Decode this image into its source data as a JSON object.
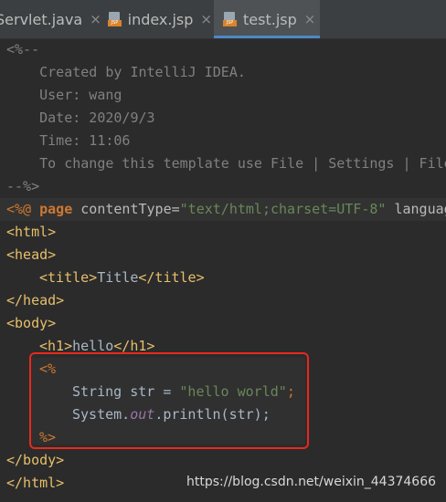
{
  "tabs": [
    {
      "label": "Servlet.java",
      "close": "×",
      "active": false
    },
    {
      "label": "index.jsp",
      "close": "×",
      "active": false
    },
    {
      "label": "test.jsp",
      "close": "×",
      "active": true
    }
  ],
  "code": {
    "comment_open": "<%--",
    "comment_lines": [
      "    Created by IntelliJ IDEA.",
      "    User: wang",
      "    Date: 2020/9/3",
      "    Time: 11:06",
      "    To change this template use File | Settings | File T"
    ],
    "comment_close": "--%>",
    "directive_open": "<%@",
    "directive_keyword": "page",
    "directive_attr": "contentType=",
    "directive_value": "\"text/html;charset=UTF-8\"",
    "directive_rest": " languag",
    "html_open": "<html>",
    "head_open": "<head>",
    "title_open": "<title>",
    "title_text": "Title",
    "title_close": "</title>",
    "head_close": "</head>",
    "body_open": "<body>",
    "h1_open": "<h1>",
    "h1_text": "hello",
    "h1_close": "</h1>",
    "scriptlet_open": "<%",
    "java_line1_a": "String str = ",
    "java_line1_str": "\"hello world\"",
    "java_line1_end": ";",
    "java_line2_a": "System.",
    "java_line2_field": "out",
    "java_line2_b": ".println(str);",
    "scriptlet_close": "%>",
    "body_close": "</body>",
    "html_close": "</html>"
  },
  "watermark": "https://blog.csdn.net/weixin_44374666",
  "colors": {
    "background": "#2b2b2b",
    "tag": "#e8bf6a",
    "keyword": "#cc7832",
    "string": "#6a8759",
    "comment": "#808080",
    "highlight_box": "#e8291e"
  }
}
